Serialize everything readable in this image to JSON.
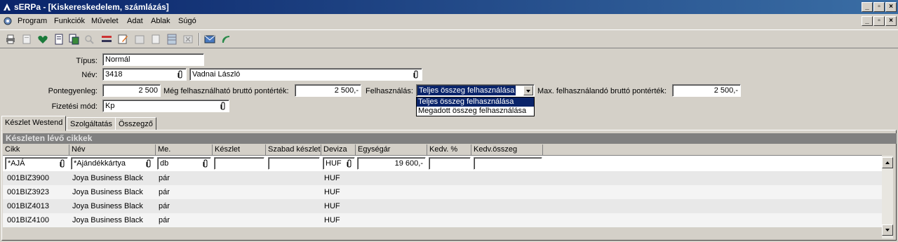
{
  "window": {
    "title": "sERPa - [Kiskereskedelem, számlázás]"
  },
  "menu": [
    "Program",
    "Funkciók",
    "Művelet",
    "Adat",
    "Ablak",
    "Súgó"
  ],
  "toolbar": {
    "icons": [
      "print-icon",
      "print-preview-icon",
      "heart-check-icon",
      "document-icon",
      "copy-doc-icon",
      "search-icon",
      "transfer-icon",
      "edit-icon",
      "calculator-icon",
      "import-icon",
      "table-icon",
      "delete-icon",
      "mail-icon",
      "phone-icon"
    ]
  },
  "form": {
    "tipus_label": "Típus:",
    "tipus_value": "Normál",
    "nev_label": "Név:",
    "nev_code": "3418",
    "nev_name": "Vadnai László",
    "pontegyenleg_label": "Pontegyenleg:",
    "pontegyenleg_value": "2 500",
    "meg_label": "Még felhasználható bruttó pontérték:",
    "meg_value": "2 500,-",
    "felhasznalas_label": "Felhasználás:",
    "felhasznalas_value": "Teljes összeg felhasználása",
    "max_label": "Max. felhasználandó bruttó pontérték:",
    "max_value": "2 500,-",
    "fizetesi_label": "Fizetési mód:",
    "fizetesi_value": "Kp",
    "dropdown_options": [
      "Teljes összeg felhasználása",
      "Megadott összeg felhasználása"
    ]
  },
  "tabs": [
    "Készlet Westend",
    "Szolgáltatás",
    "Összegző"
  ],
  "grid": {
    "title": "Készleten lévő cikkek",
    "columns": [
      "Cikk",
      "Név",
      "Me.",
      "Készlet",
      "Szabad készlet",
      "Deviza",
      "Egységár",
      "Kedv. %",
      "Kedv.összeg"
    ],
    "filters": {
      "cikk": "*AJÁ",
      "nev": "*Ajándékkártya",
      "me": "db",
      "keszlet": "",
      "szabad": "",
      "deviza": "HUF",
      "egysegar": "19 600,-",
      "kedv_pct": "",
      "kedv_osszeg": ""
    },
    "rows": [
      {
        "cikk": "001BIZ3900",
        "nev": "Joya Business Black",
        "me": "pár",
        "deviza": "HUF"
      },
      {
        "cikk": "001BIZ3923",
        "nev": "Joya Business Black",
        "me": "pár",
        "deviza": "HUF"
      },
      {
        "cikk": "001BIZ4013",
        "nev": "Joya Business Black",
        "me": "pár",
        "deviza": "HUF"
      },
      {
        "cikk": "001BIZ4100",
        "nev": "Joya Business Black",
        "me": "pár",
        "deviza": "HUF"
      }
    ]
  }
}
